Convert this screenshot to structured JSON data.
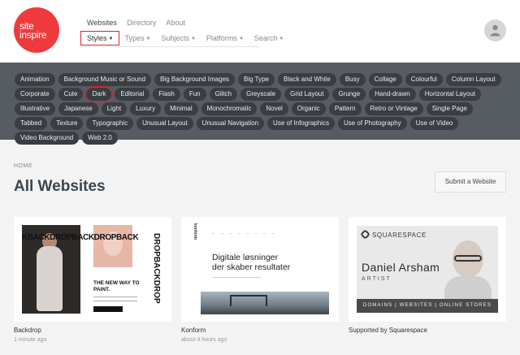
{
  "logo": {
    "line1": "site",
    "line2": "inspire"
  },
  "topnav": {
    "websites": "Websites",
    "directory": "Directory",
    "about": "About"
  },
  "filternav": [
    "Styles",
    "Types",
    "Subjects",
    "Platforms",
    "Search"
  ],
  "tags": [
    "Animation",
    "Background Music or Sound",
    "Big Background Images",
    "Big Type",
    "Black and White",
    "Busy",
    "Collage",
    "Colourful",
    "Column Layout",
    "Corporate",
    "Cute",
    "Dark",
    "Editorial",
    "Flash",
    "Fun",
    "Glitch",
    "Greyscale",
    "Grid Layout",
    "Grunge",
    "Hand-drawn",
    "Horizontal Layout",
    "Illustrative",
    "Japanese",
    "Light",
    "Luxury",
    "Minimal",
    "Monochromatic",
    "Novel",
    "Organic",
    "Pattern",
    "Retro or Vintage",
    "Single Page",
    "Tabbed",
    "Texture",
    "Typographic",
    "Unusual Layout",
    "Unusual Navigation",
    "Use of Infographics",
    "Use of Photography",
    "Use of Video",
    "Video Background",
    "Web 2.0"
  ],
  "selected_tag": "Dark",
  "breadcrumb": "HOME",
  "page_title": "All Websites",
  "submit_label": "Submit a Website",
  "cards": [
    {
      "name": "Backdrop",
      "time": "1 minute ago",
      "preview": {
        "wordmark": "KBACKDROPBACKDROPBACK",
        "vertical": "DROPBACKDROP",
        "headline": "THE NEW WAY TO PAINT."
      }
    },
    {
      "name": "Konform",
      "time": "about 4 hours ago",
      "preview": {
        "logo": "konform",
        "headline_1": "Digitale løsninger",
        "headline_2": "der skaber resultater"
      }
    },
    {
      "name": "Supported by Squarespace",
      "time": "",
      "preview": {
        "brand": "SQUARESPACE",
        "person": "Daniel Arsham",
        "role": "ARTIST",
        "bar": "DOMAINS | WEBSITES | ONLINE STORES"
      }
    }
  ],
  "colors": {
    "brand_red": "#ee3a3c",
    "tag_bar": "#575c63",
    "tag_pill": "#3a3e43",
    "selection": "#d8242a"
  }
}
